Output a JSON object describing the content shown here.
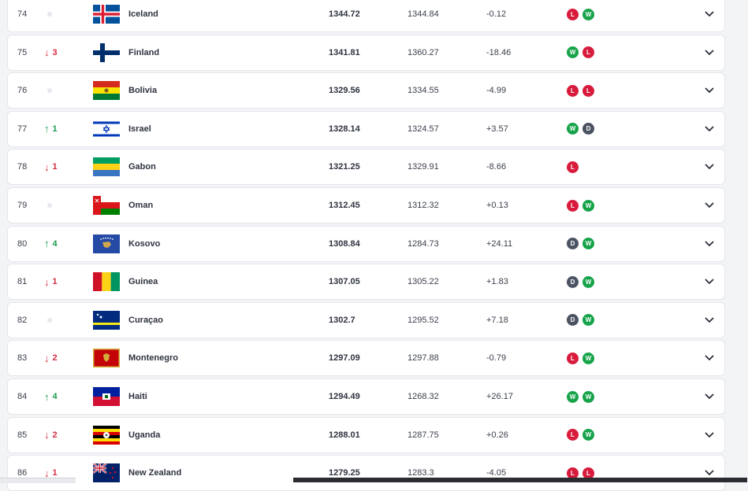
{
  "rows": [
    {
      "rank": "74",
      "move_dir": "none",
      "move_val": "",
      "flag": "iceland-flag",
      "country": "Iceland",
      "points": "1344.72",
      "prev": "1344.84",
      "diff": "-0.12",
      "form": [
        "L",
        "W"
      ]
    },
    {
      "rank": "75",
      "move_dir": "down",
      "move_val": "3",
      "flag": "finland-flag",
      "country": "Finland",
      "points": "1341.81",
      "prev": "1360.27",
      "diff": "-18.46",
      "form": [
        "W",
        "L"
      ]
    },
    {
      "rank": "76",
      "move_dir": "none",
      "move_val": "",
      "flag": "bolivia-flag",
      "country": "Bolivia",
      "points": "1329.56",
      "prev": "1334.55",
      "diff": "-4.99",
      "form": [
        "L",
        "L"
      ]
    },
    {
      "rank": "77",
      "move_dir": "up",
      "move_val": "1",
      "flag": "israel-flag",
      "country": "Israel",
      "points": "1328.14",
      "prev": "1324.57",
      "diff": "+3.57",
      "form": [
        "W",
        "D"
      ]
    },
    {
      "rank": "78",
      "move_dir": "down",
      "move_val": "1",
      "flag": "gabon-flag",
      "country": "Gabon",
      "points": "1321.25",
      "prev": "1329.91",
      "diff": "-8.66",
      "form": [
        "L"
      ]
    },
    {
      "rank": "79",
      "move_dir": "none",
      "move_val": "",
      "flag": "oman-flag",
      "country": "Oman",
      "points": "1312.45",
      "prev": "1312.32",
      "diff": "+0.13",
      "form": [
        "L",
        "W"
      ]
    },
    {
      "rank": "80",
      "move_dir": "up",
      "move_val": "4",
      "flag": "kosovo-flag",
      "country": "Kosovo",
      "points": "1308.84",
      "prev": "1284.73",
      "diff": "+24.11",
      "form": [
        "D",
        "W"
      ]
    },
    {
      "rank": "81",
      "move_dir": "down",
      "move_val": "1",
      "flag": "guinea-flag",
      "country": "Guinea",
      "points": "1307.05",
      "prev": "1305.22",
      "diff": "+1.83",
      "form": [
        "D",
        "W"
      ]
    },
    {
      "rank": "82",
      "move_dir": "none",
      "move_val": "",
      "flag": "curacao-flag",
      "country": "Curaçao",
      "points": "1302.7",
      "prev": "1295.52",
      "diff": "+7.18",
      "form": [
        "D",
        "W"
      ]
    },
    {
      "rank": "83",
      "move_dir": "down",
      "move_val": "2",
      "flag": "montenegro-flag",
      "country": "Montenegro",
      "points": "1297.09",
      "prev": "1297.88",
      "diff": "-0.79",
      "form": [
        "L",
        "W"
      ]
    },
    {
      "rank": "84",
      "move_dir": "up",
      "move_val": "4",
      "flag": "haiti-flag",
      "country": "Haiti",
      "points": "1294.49",
      "prev": "1268.32",
      "diff": "+26.17",
      "form": [
        "W",
        "W"
      ]
    },
    {
      "rank": "85",
      "move_dir": "down",
      "move_val": "2",
      "flag": "uganda-flag",
      "country": "Uganda",
      "points": "1288.01",
      "prev": "1287.75",
      "diff": "+0.26",
      "form": [
        "L",
        "W"
      ]
    },
    {
      "rank": "86",
      "move_dir": "down",
      "move_val": "1",
      "flag": "new-zealand-flag",
      "country": "New Zealand",
      "points": "1279.25",
      "prev": "1283.3",
      "diff": "-4.05",
      "form": [
        "L",
        "L"
      ]
    }
  ],
  "icons": {
    "up": "arrow-up-icon",
    "down": "arrow-down-icon",
    "none": "no-change-dot-icon",
    "expand": "chevron-down-icon"
  },
  "colors": {
    "up": "#1a9b4e",
    "down": "#d52a3f",
    "win": "#16a34a",
    "loss": "#d81b3c",
    "draw": "#4b5262"
  }
}
